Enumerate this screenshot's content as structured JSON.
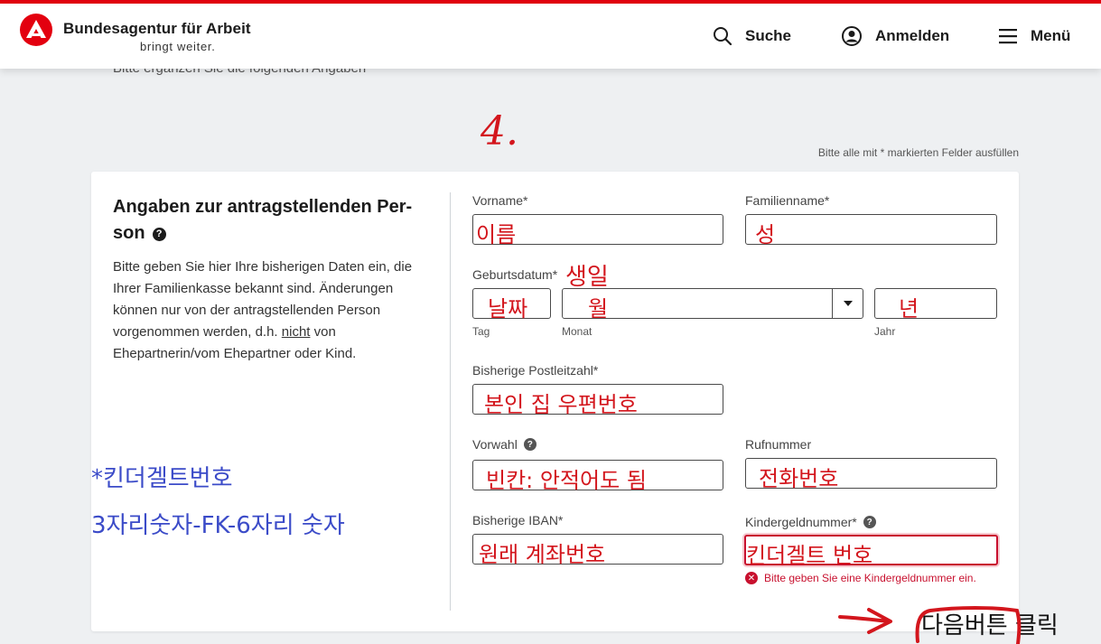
{
  "header": {
    "org_name": "Bundesagentur für Arbeit",
    "slogan": "bringt weiter.",
    "search_label": "Suche",
    "login_label": "Anmelden",
    "menu_label": "Menü"
  },
  "page": {
    "scrolled_text": "Bitte ergänzen Sie die folgenden Angaben",
    "required_hint": "Bitte alle mit * markierten Felder ausfüllen"
  },
  "section": {
    "title": "Angaben zur antragstellenden Per-son",
    "help_icon": "?",
    "desc_before": "Bitte geben Sie hier Ihre bisherigen Daten ein, die Ihrer Familienkasse bekannt sind. Änderungen können nur von der antragstellenden Person vorgenommen werden, d.h. ",
    "desc_underlined": "nicht",
    "desc_after": " von Ehepartnerin/vom Ehepartner oder Kind."
  },
  "form": {
    "vorname_label": "Vorname*",
    "vorname_value": "이름",
    "familienname_label": "Familienname*",
    "familienname_value": "성",
    "geburtsdatum_label": "Geburtsdatum*",
    "tag_value": "날짜",
    "tag_sub": "Tag",
    "monat_value": "월",
    "monat_sub": "Monat",
    "jahr_value": "년",
    "jahr_sub": "Jahr",
    "plz_label": "Bisherige Postleitzahl*",
    "plz_value": "본인 집 우편번호",
    "vorwahl_label": "Vorwahl",
    "vorwahl_value": "빈칸: 안적어도 됨",
    "rufnummer_label": "Rufnummer",
    "rufnummer_value": "전화번호",
    "iban_label": "Bisherige IBAN*",
    "iban_value": "원래 계좌번호",
    "kindergeld_label": "Kindergeldnummer*",
    "kindergeld_value": "킨더겔트 번호",
    "kindergeld_error": "Bitte geben Sie eine Kindergeldnummer ein."
  },
  "annotations": {
    "step_number": "4.",
    "birthday_note": "생일",
    "blue_note_1": "*킨더겔트번호",
    "blue_note_2": "3자리숫자-FK-6자리 숫자",
    "next_note": "다음버튼 클릭"
  },
  "colors": {
    "brand_red": "#e3000f",
    "annotation_red": "#d3161d",
    "annotation_blue": "#3b4bc8",
    "error_red": "#c8102e"
  }
}
